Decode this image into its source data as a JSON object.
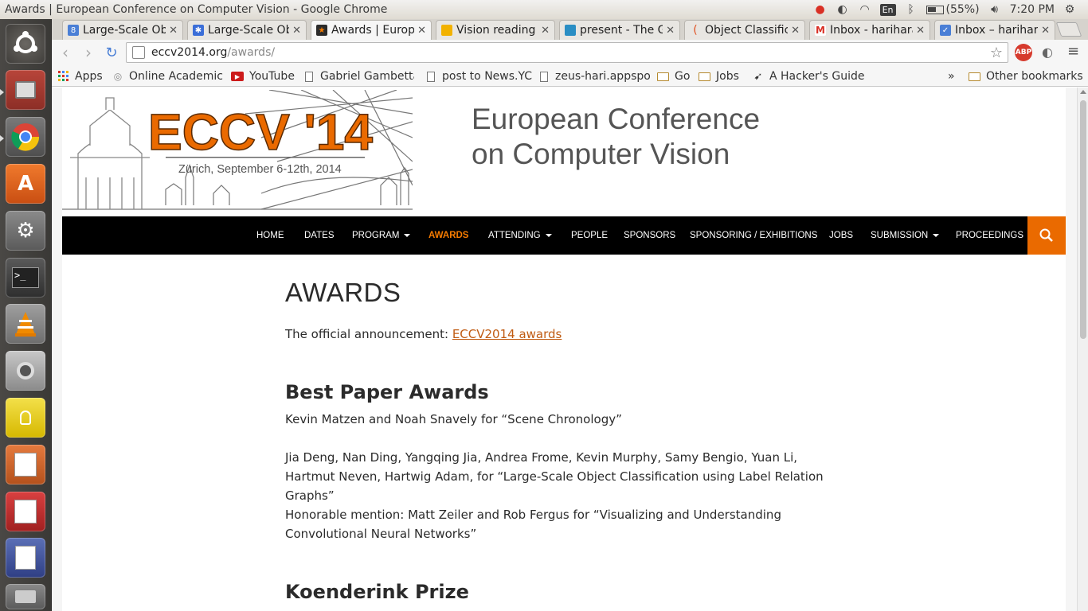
{
  "os": {
    "window_title": "Awards | European Conference on Computer Vision - Google Chrome",
    "battery": "(55%)",
    "clock": "7:20 PM",
    "keyboard_layout": "En"
  },
  "launcher": {
    "items": [
      "ubuntu-dash",
      "files",
      "chrome",
      "software-center",
      "system-settings",
      "terminal",
      "vlc",
      "music-player",
      "notes",
      "impress",
      "evince",
      "gedit",
      "trash"
    ]
  },
  "tabs": [
    {
      "title": "Large-Scale Ob",
      "color": "#4a7fd6"
    },
    {
      "title": "Large-Scale Ob",
      "color": "#3b6ed8"
    },
    {
      "title": "Awards | Europ",
      "color": "#2b2b2b"
    },
    {
      "title": "Vision reading",
      "color": "#f2b200"
    },
    {
      "title": "present - The G",
      "color": "#2a8ec4"
    },
    {
      "title": "Object Classific",
      "color": "#e05020"
    },
    {
      "title": "Inbox - harihara",
      "color": "#d93025"
    },
    {
      "title": "Inbox – harihar",
      "color": "#4a7fd6"
    }
  ],
  "omnibox": {
    "host": "eccv2014.org",
    "path": "/awards/"
  },
  "bookmarks": {
    "items": [
      {
        "label": "Apps"
      },
      {
        "label": "Online Academic"
      },
      {
        "label": "YouTube"
      },
      {
        "label": "Gabriel Gambetta"
      },
      {
        "label": "post to News.YC"
      },
      {
        "label": "zeus-hari.appspo"
      },
      {
        "label": "Go"
      },
      {
        "label": "Jobs"
      },
      {
        "label": "A Hacker's Guide"
      }
    ],
    "overflow": "»",
    "other": "Other bookmarks"
  },
  "site": {
    "logo_text": "ECCV '14",
    "logo_subtitle": "Zürich, September 6-12th, 2014",
    "title_line1": "European Conference",
    "title_line2": "on Computer Vision",
    "accent": "#f57b00",
    "nav": [
      {
        "label": "HOME"
      },
      {
        "label": "DATES"
      },
      {
        "label": "PROGRAM"
      },
      {
        "label": "AWARDS"
      },
      {
        "label": "ATTENDING"
      },
      {
        "label": "PEOPLE"
      },
      {
        "label": "SPONSORS"
      },
      {
        "label": "SPONSORING / EXHIBITIONS"
      },
      {
        "label": "JOBS"
      },
      {
        "label": "SUBMISSION"
      },
      {
        "label": "PROCEEDINGS"
      }
    ]
  },
  "content": {
    "page_title": "AWARDS",
    "announcement_prefix": "The official announcement: ",
    "announcement_link": "ECCV2014 awards",
    "best_paper_heading": "Best Paper Awards",
    "best_paper_1": "Kevin Matzen and Noah Snavely for “Scene Chronology”",
    "best_paper_2": "Jia Deng, Nan Ding, Yangqing Jia, Andrea Frome, Kevin Murphy, Samy Bengio, Yuan Li, Hartmut Neven, Hartwig Adam, for “Large-Scale Object Classification using Label Relation Graphs”",
    "honorable_mention": "Honorable mention: Matt Zeiler and Rob Fergus for “Visualizing and Understanding Convolutional Neural Networks”",
    "koenderink_heading": "Koenderink Prize"
  }
}
